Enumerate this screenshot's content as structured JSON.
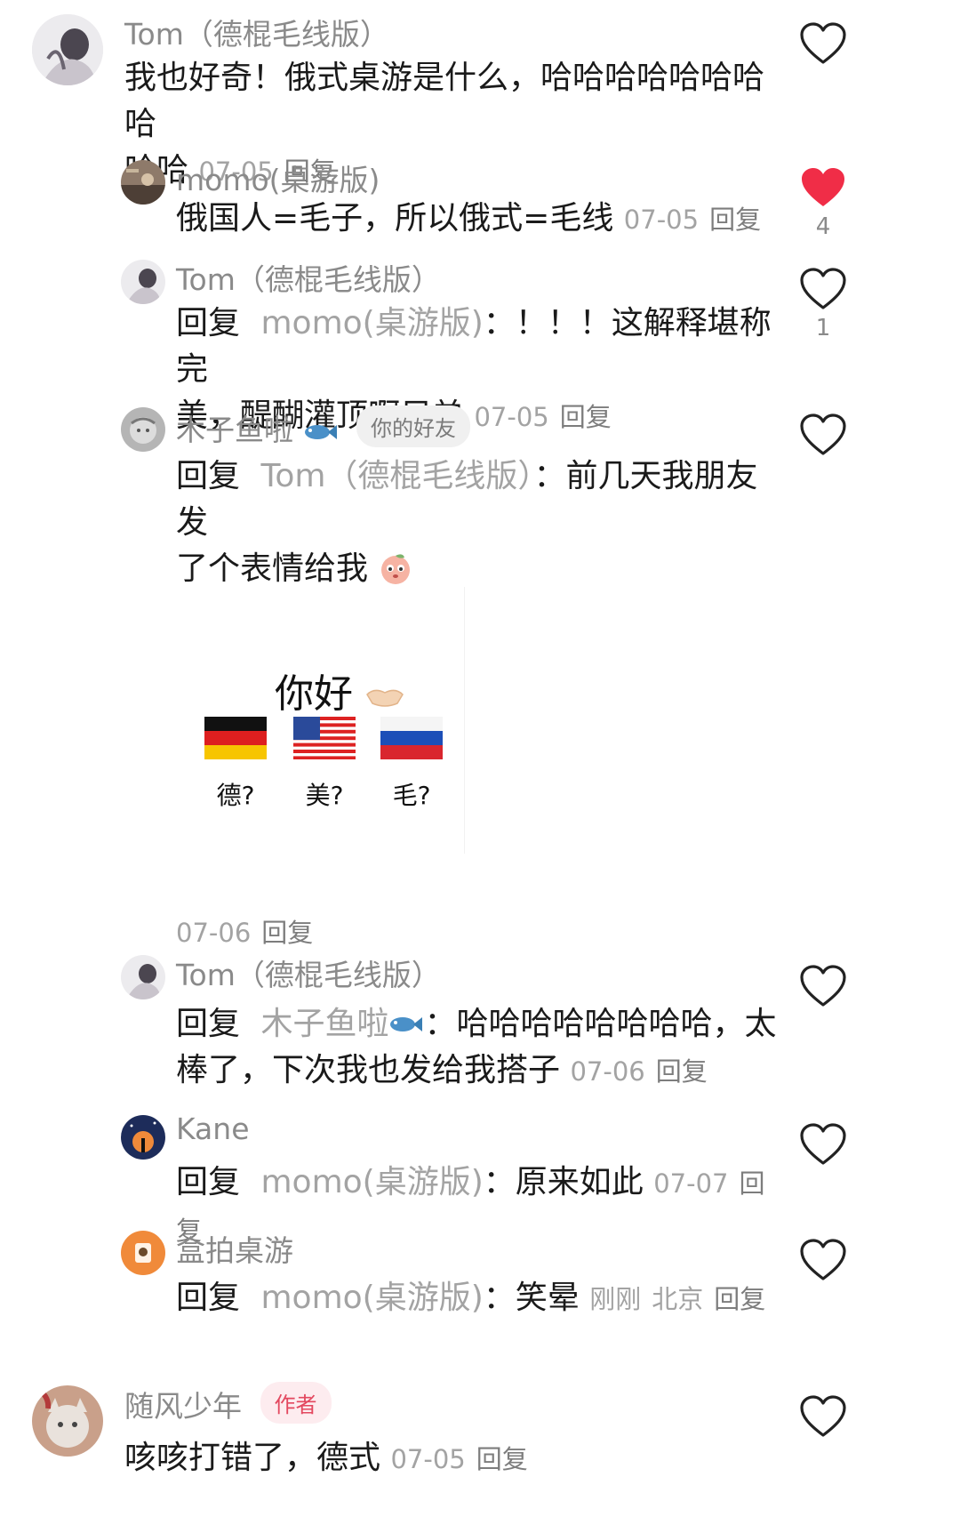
{
  "comments": [
    {
      "user": "Tom（德棍毛线版）",
      "text_line1": "我也好奇！俄式桌游是什么，哈哈哈哈哈哈哈哈",
      "text_line2": "哈哈",
      "date": "07-05",
      "reply": "回复",
      "likes": ""
    },
    {
      "user": "momo(桌游版)",
      "text": "俄国人=毛子，所以俄式=毛线",
      "date": "07-05",
      "reply": "回复",
      "likes": "4",
      "liked": true
    },
    {
      "user": "Tom（德棍毛线版）",
      "reply_prefix": "回复",
      "reply_to": "momo(桌游版)",
      "text_line1_rest": "：！！！这解释堪称完",
      "text_line2": "美，醍醐灌顶啊兄弟",
      "date": "07-05",
      "reply": "回复",
      "likes": "1"
    },
    {
      "user": "木子鱼啦",
      "badge": "你的好友",
      "reply_prefix": "回复",
      "reply_to": "Tom（德棍毛线版）",
      "text_line1_rest": "：前几天我朋友发",
      "text_line2": "了个表情给我",
      "sticker": {
        "title": "你好",
        "labels": [
          "德?",
          "美?",
          "毛?"
        ]
      },
      "date": "07-06",
      "reply": "回复",
      "likes": ""
    },
    {
      "user": "Tom（德棍毛线版）",
      "reply_prefix": "回复",
      "reply_to": "木子鱼啦",
      "text_line1_rest": "：哈哈哈哈哈哈哈哈，太",
      "text_line2": "棒了，下次我也发给我搭子",
      "date": "07-06",
      "reply": "回复",
      "likes": ""
    },
    {
      "user": "Kane",
      "reply_prefix": "回复",
      "reply_to": "momo(桌游版)",
      "text_rest": "：原来如此",
      "date": "07-07",
      "reply": "回复",
      "likes": ""
    },
    {
      "user": "盒拍桌游",
      "reply_prefix": "回复",
      "reply_to": "momo(桌游版)",
      "text_rest": "：笑晕",
      "date": "刚刚",
      "location": "北京",
      "reply": "回复",
      "likes": ""
    },
    {
      "user": "随风少年",
      "badge": "作者",
      "text": "咳咳打错了，德式",
      "date": "07-05",
      "reply": "回复",
      "likes": ""
    }
  ],
  "colors": {
    "liked_heart": "#f02d47",
    "heart_outline": "#222222",
    "username": "#8a8a8a",
    "author_badge": "#e3485f"
  },
  "icons": {
    "like": "heart-outline-icon",
    "liked": "heart-filled-icon",
    "fish": "fish-emoji-icon"
  }
}
